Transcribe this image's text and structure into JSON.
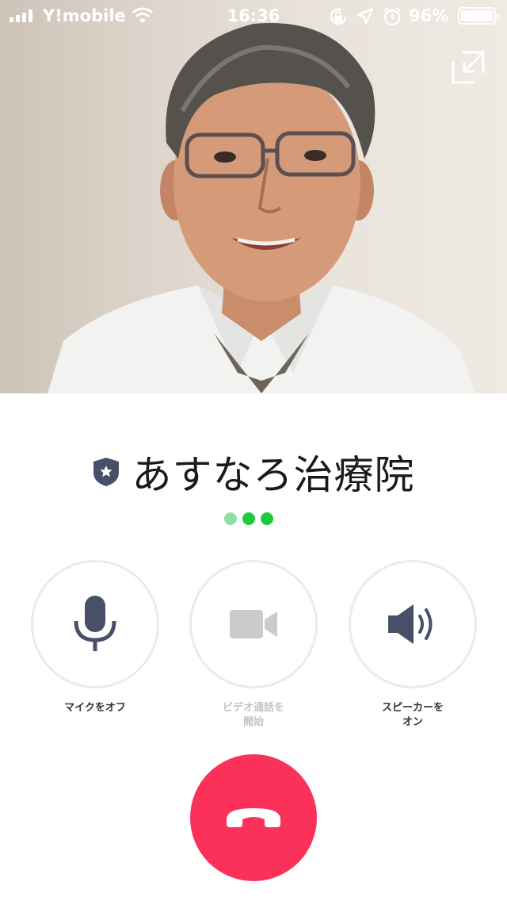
{
  "status_bar": {
    "carrier": "Y!mobile",
    "time": "16:36",
    "battery": "96%"
  },
  "call": {
    "caller_name": "あすなろ治療院",
    "connecting_dots_colors": [
      "#8ee0a0",
      "#1ec93a",
      "#1ec93a"
    ]
  },
  "actions": [
    {
      "label": "マイクをオフ",
      "icon": "microphone-icon",
      "enabled": true
    },
    {
      "label_lines": [
        "ビデオ通話を",
        "開始"
      ],
      "icon": "video-camera-icon",
      "enabled": false
    },
    {
      "label_lines": [
        "スピーカーを",
        "オン"
      ],
      "icon": "speaker-icon",
      "enabled": true
    }
  ],
  "hangup": {
    "icon": "hangup-phone-icon",
    "color": "#fb3159"
  },
  "colors": {
    "icon_active": "#475068",
    "icon_disabled": "#cbcbcb",
    "accent_green": "#1ec93a"
  }
}
